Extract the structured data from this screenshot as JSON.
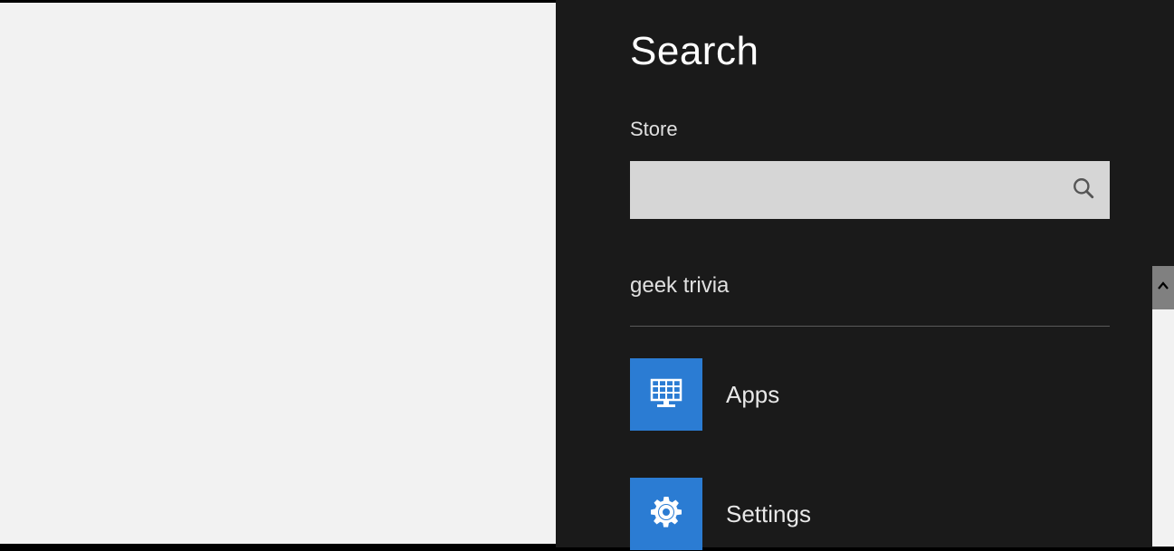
{
  "charm": {
    "title": "Search",
    "scope": "Store",
    "input_value": "",
    "suggestion": "geek trivia",
    "categories": [
      {
        "icon": "apps-icon",
        "label": "Apps"
      },
      {
        "icon": "settings-icon",
        "label": "Settings"
      }
    ]
  },
  "colors": {
    "tile": "#2b7cd3",
    "panel": "#1a1a1a",
    "left": "#f2f2f2"
  }
}
